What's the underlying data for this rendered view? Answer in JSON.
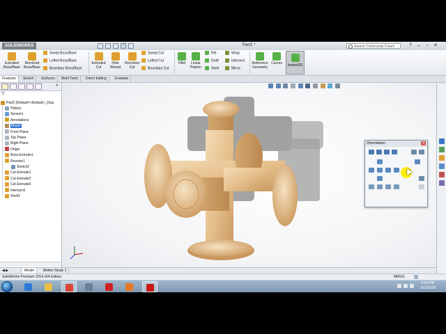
{
  "titlebar": {
    "app_logo": "SOLIDWORKS",
    "doc_title": "Part2 *",
    "search_placeholder": "Search Community Forum",
    "window_buttons": [
      "–",
      "▫",
      "✕"
    ]
  },
  "ribbon": {
    "big": [
      {
        "label1": "Extruded",
        "label2": "Boss/Base",
        "color": "#e0a030"
      },
      {
        "label1": "Revolved",
        "label2": "Boss/Base",
        "color": "#e0a030"
      },
      {
        "label1": "Extruded",
        "label2": "Cut",
        "color": "#e0a030"
      },
      {
        "label1": "Hole",
        "label2": "Wizard",
        "color": "#e0a030"
      },
      {
        "label1": "Revolved",
        "label2": "Cut",
        "color": "#e0a030"
      },
      {
        "label1": "Fillet",
        "label2": "",
        "color": "#58b048"
      },
      {
        "label1": "Linear",
        "label2": "Pattern",
        "color": "#58b048"
      },
      {
        "label1": "Reference",
        "label2": "Geometry",
        "color": "#58b048"
      },
      {
        "label1": "Curves",
        "label2": "",
        "color": "#58b048"
      },
      {
        "label1": "Instant3D",
        "label2": "",
        "color": "#58b048"
      }
    ],
    "small_boss": [
      "Swept Boss/Base",
      "Lofted Boss/Base",
      "Boundary Boss/Base"
    ],
    "small_cut": [
      "Swept Cut",
      "Lofted Cut",
      "Boundary Cut"
    ],
    "small_features": [
      "Rib",
      "Draft",
      "Shell"
    ],
    "small_misc": [
      "Wrap",
      "Intersect",
      "Mirror"
    ]
  },
  "cm_tabs": [
    "Features",
    "Sketch",
    "Surfaces",
    "Mold Tools",
    "Direct Editing",
    "Evaluate"
  ],
  "feature_tree": {
    "root": "Part2  (Default<<Default>_Disp",
    "items": [
      {
        "label": "History",
        "color": "#8aa4c0",
        "indent": 1,
        "selected": false
      },
      {
        "label": "Sensors",
        "color": "#6a9ad0",
        "indent": 1,
        "selected": false
      },
      {
        "label": "Annotations",
        "color": "#d0a020",
        "indent": 1,
        "selected": false
      },
      {
        "label": "Maple",
        "color": "#b08a5a",
        "indent": 1,
        "selected": true
      },
      {
        "label": "Front Plane",
        "color": "#aab4c0",
        "indent": 1,
        "selected": false
      },
      {
        "label": "Top Plane",
        "color": "#aab4c0",
        "indent": 1,
        "selected": false
      },
      {
        "label": "Right Plane",
        "color": "#aab4c0",
        "indent": 1,
        "selected": false
      },
      {
        "label": "Origin",
        "color": "#c04040",
        "indent": 1,
        "selected": false
      },
      {
        "label": "Boss-Extrude1",
        "color": "#e0a030",
        "indent": 1,
        "selected": false
      },
      {
        "label": "Revolve1",
        "color": "#e0a030",
        "indent": 1,
        "selected": false
      },
      {
        "label": "Sketch2",
        "color": "#7090b0",
        "indent": 2,
        "selected": false
      },
      {
        "label": "Cut-Extrude1",
        "color": "#e0a030",
        "indent": 1,
        "selected": false
      },
      {
        "label": "Cut-Extrude2",
        "color": "#e0a030",
        "indent": 1,
        "selected": false
      },
      {
        "label": "Cut-Extrude3",
        "color": "#e0a030",
        "indent": 1,
        "selected": false
      },
      {
        "label": "Intersect1",
        "color": "#e0a030",
        "indent": 1,
        "selected": false
      },
      {
        "label": "Shell1",
        "color": "#e0a030",
        "indent": 1,
        "selected": false
      }
    ]
  },
  "orientation": {
    "title": "Orientation",
    "close": "x"
  },
  "bottom_tabs": [
    "Model",
    "Motion Study 1"
  ],
  "status": {
    "left": "SolidWorks Premium 2014 x64 Edition",
    "units": "MMGS"
  },
  "taskbar": {
    "apps": [
      {
        "name": "internet-explorer",
        "color": "#2b7bd6",
        "active": false
      },
      {
        "name": "file-explorer",
        "color": "#e8c048",
        "active": false
      },
      {
        "name": "chrome",
        "color": "#d8453a",
        "active": true
      },
      {
        "name": "screen-recorder",
        "color": "#6f7f93",
        "active": false
      },
      {
        "name": "solidworks",
        "color": "#d02020",
        "active": false
      },
      {
        "name": "firefox",
        "color": "#e77826",
        "active": false
      },
      {
        "name": "solidworks-2",
        "color": "#c81818",
        "active": true
      }
    ],
    "time": "8:53 PM",
    "date": "3/12/2018"
  }
}
